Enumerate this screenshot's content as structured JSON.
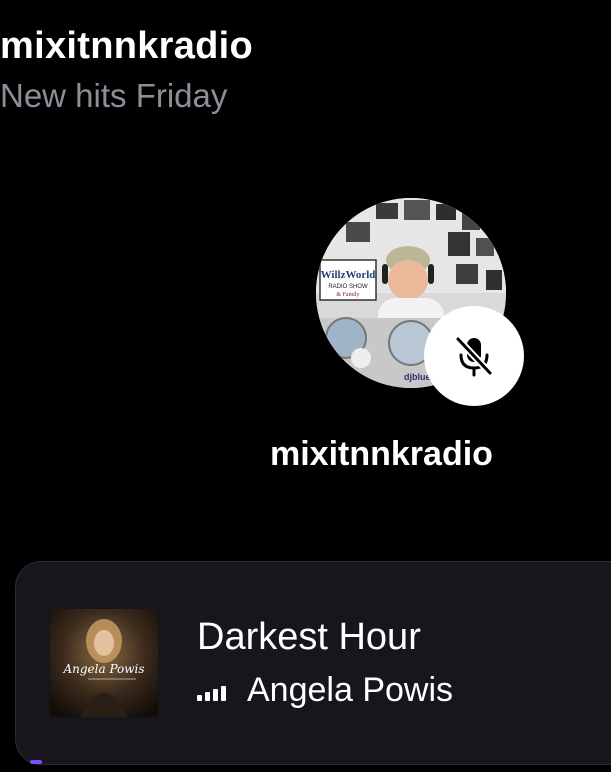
{
  "room": {
    "title": "mixitnnkradio",
    "subtitle": "New hits Friday"
  },
  "speaker": {
    "name": "mixitnnkradio",
    "mic_status": "muted",
    "avatar_text": {
      "show_name": "WillzWorld",
      "show_sub": "RADIO SHOW",
      "show_family": "& Family",
      "handle": "djblue"
    }
  },
  "now_playing": {
    "title": "Darkest Hour",
    "artist": "Angela Powis",
    "album_art_text": "Angela Powis"
  },
  "colors": {
    "background": "#000000",
    "subtitle": "#8e8e99",
    "player_bg": "#16161c",
    "accent": "#7b4dff"
  },
  "icons": {
    "mute": "mic-off-icon",
    "playing": "equalizer-icon"
  }
}
